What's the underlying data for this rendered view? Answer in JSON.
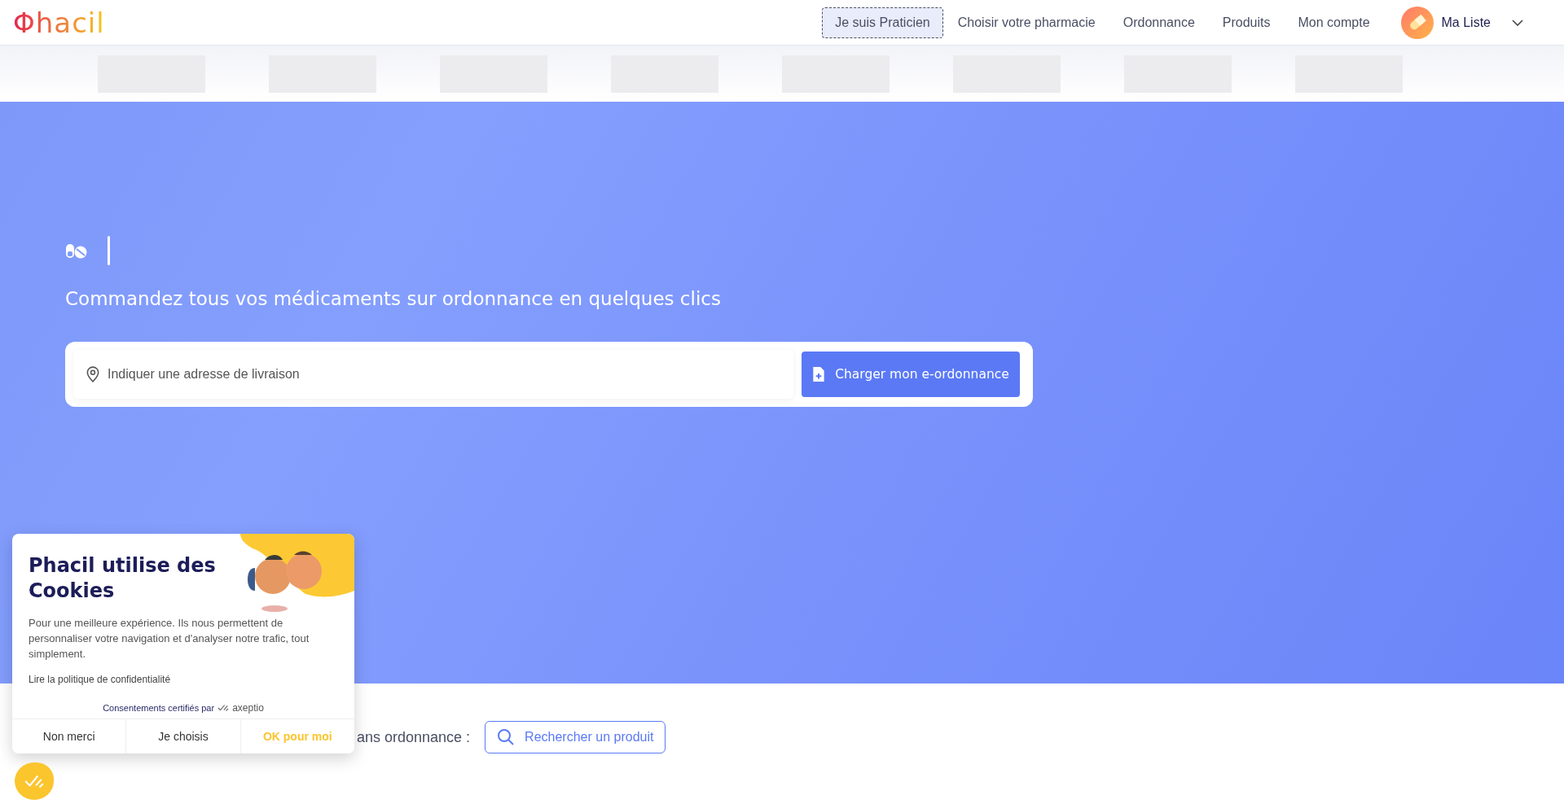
{
  "header": {
    "logo": "Φhacil",
    "nav": [
      {
        "label": "Je suis Praticien",
        "focused": true
      },
      {
        "label": "Choisir votre pharmacie",
        "focused": false
      },
      {
        "label": "Ordonnance",
        "focused": false
      },
      {
        "label": "Produits",
        "focused": false
      },
      {
        "label": "Mon compte",
        "focused": false
      }
    ],
    "account": {
      "label": "Ma Liste"
    }
  },
  "hero": {
    "headline": "Commandez tous vos médicaments sur ordonnance en quelques clics",
    "search": {
      "placeholder": "Indiquer une adresse de livraison"
    },
    "upload_button": "Charger mon e-ordonnance"
  },
  "products_row": {
    "text": "ans ordonnance :",
    "button": "Rechercher un produit"
  },
  "cookie_banner": {
    "title": "Phacil utilise des Cookies",
    "body": "Pour une meilleure expérience. Ils nous permettent de personnaliser votre navigation et d'analyser notre trafic, tout simplement.",
    "policy_link": "Lire la politique de confidentialité",
    "certified_by": "Consentements certifiés par",
    "brand": "axeptio",
    "buttons": [
      {
        "label": "Non merci",
        "kind": "plain"
      },
      {
        "label": "Je choisis",
        "kind": "plain"
      },
      {
        "label": "OK pour moi",
        "kind": "accept"
      }
    ]
  }
}
